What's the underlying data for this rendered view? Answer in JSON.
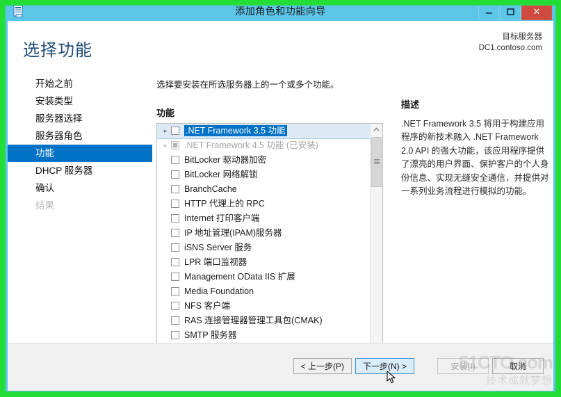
{
  "window": {
    "title": "添加角色和功能向导",
    "icon": "server-manager-icon",
    "minimize_label": "—",
    "maximize_label": "❐",
    "close_label": "✕",
    "titlebar_color": "#5cc6e8",
    "accent_color": "#0072c6"
  },
  "header": {
    "page_title": "选择功能",
    "destination_label": "目标服务器",
    "destination_server": "DC1.contoso.com"
  },
  "sidebar": {
    "items": [
      {
        "label": "开始之前",
        "state": "normal"
      },
      {
        "label": "安装类型",
        "state": "normal"
      },
      {
        "label": "服务器选择",
        "state": "normal"
      },
      {
        "label": "服务器角色",
        "state": "normal"
      },
      {
        "label": "功能",
        "state": "active"
      },
      {
        "label": "DHCP 服务器",
        "state": "normal"
      },
      {
        "label": "确认",
        "state": "normal"
      },
      {
        "label": "结果",
        "state": "disabled"
      }
    ]
  },
  "main": {
    "instruction": "选择要安装在所选服务器上的一个或多个功能。",
    "section_label": "功能",
    "features": [
      {
        "label": ".NET Framework 3.5 功能",
        "checked": false,
        "expandable": true,
        "selected": true,
        "installed": false
      },
      {
        "label": ".NET Framework 4.5 功能 (已安装)",
        "checked": true,
        "expandable": true,
        "selected": false,
        "installed": true
      },
      {
        "label": "BitLocker 驱动器加密",
        "checked": false,
        "expandable": false,
        "selected": false,
        "installed": false
      },
      {
        "label": "BitLocker 网络解锁",
        "checked": false,
        "expandable": false,
        "selected": false,
        "installed": false
      },
      {
        "label": "BranchCache",
        "checked": false,
        "expandable": false,
        "selected": false,
        "installed": false
      },
      {
        "label": "HTTP 代理上的 RPC",
        "checked": false,
        "expandable": false,
        "selected": false,
        "installed": false
      },
      {
        "label": "Internet 打印客户端",
        "checked": false,
        "expandable": false,
        "selected": false,
        "installed": false
      },
      {
        "label": "IP 地址管理(IPAM)服务器",
        "checked": false,
        "expandable": false,
        "selected": false,
        "installed": false
      },
      {
        "label": "iSNS Server 服务",
        "checked": false,
        "expandable": false,
        "selected": false,
        "installed": false
      },
      {
        "label": "LPR 端口监视器",
        "checked": false,
        "expandable": false,
        "selected": false,
        "installed": false
      },
      {
        "label": "Management OData IIS 扩展",
        "checked": false,
        "expandable": false,
        "selected": false,
        "installed": false
      },
      {
        "label": "Media Foundation",
        "checked": false,
        "expandable": false,
        "selected": false,
        "installed": false
      },
      {
        "label": "NFS 客户端",
        "checked": false,
        "expandable": false,
        "selected": false,
        "installed": false
      },
      {
        "label": "RAS 连接管理器管理工具包(CMAK)",
        "checked": false,
        "expandable": false,
        "selected": false,
        "installed": false
      },
      {
        "label": "SMTP 服务器",
        "checked": false,
        "expandable": false,
        "selected": false,
        "installed": false
      }
    ],
    "scrollbar": {
      "up_arrow": "⌃",
      "down_arrow": "⌄"
    }
  },
  "description": {
    "title": "描述",
    "text": ".NET Framework 3.5 将用于构建应用程序的新技术融入 .NET Framework 2.0 API 的强大功能，该应用程序提供了漂亮的用户界面、保护客户的个人身份信息、实现无缝安全通信，并提供对一系列业务流程进行模拟的功能。"
  },
  "footer": {
    "previous_label": "< 上一步(P)",
    "next_label": "下一步(N) >",
    "install_label": "安装(I)",
    "cancel_label": "取消"
  },
  "watermark": {
    "line1": "51CTO.com",
    "line2": "技术成就梦想"
  }
}
